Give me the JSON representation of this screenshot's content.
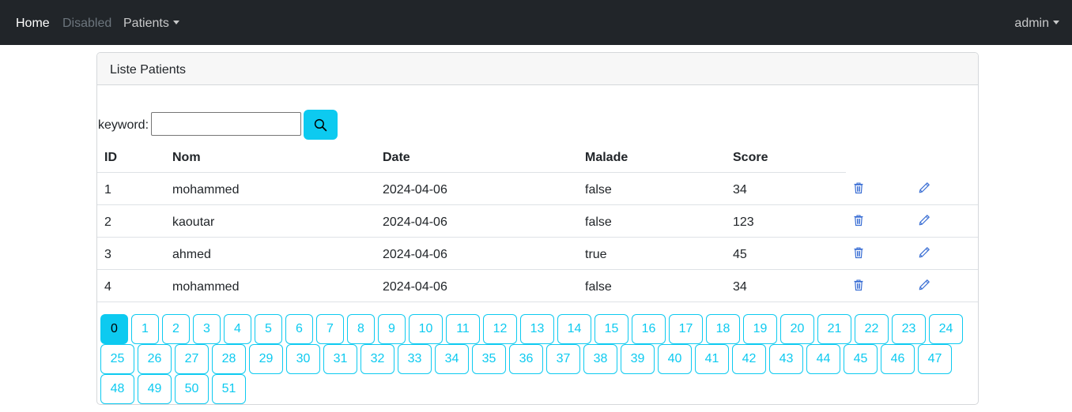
{
  "navbar": {
    "home": "Home",
    "disabled": "Disabled",
    "patients": "Patients",
    "user": "admin"
  },
  "card": {
    "title": "Liste Patients"
  },
  "search": {
    "label": "keyword:",
    "value": "",
    "button_icon": "search-icon"
  },
  "table": {
    "columns": [
      "ID",
      "Nom",
      "Date",
      "Malade",
      "Score"
    ],
    "rows": [
      [
        "1",
        "mohammed",
        "2024-04-06",
        "false",
        "34"
      ],
      [
        "2",
        "kaoutar",
        "2024-04-06",
        "false",
        "123"
      ],
      [
        "3",
        "ahmed",
        "2024-04-06",
        "true",
        "45"
      ],
      [
        "4",
        "mohammed",
        "2024-04-06",
        "false",
        "34"
      ]
    ],
    "row_actions": [
      "trash-icon",
      "pencil-icon"
    ]
  },
  "pagination": {
    "pages": [
      "0",
      "1",
      "2",
      "3",
      "4",
      "5",
      "6",
      "7",
      "8",
      "9",
      "10",
      "11",
      "12",
      "13",
      "14",
      "15",
      "16",
      "17",
      "18",
      "19",
      "20",
      "21",
      "22",
      "23",
      "24",
      "25",
      "26",
      "27",
      "28",
      "29",
      "30",
      "31",
      "32",
      "33",
      "34",
      "35",
      "36",
      "37",
      "38",
      "39",
      "40",
      "41",
      "42",
      "43",
      "44",
      "45",
      "46",
      "47",
      "48",
      "49",
      "50",
      "51"
    ],
    "current": "0"
  },
  "colors": {
    "navbar_bg": "#212529",
    "info": "#0dcaf0",
    "action_icon": "#3b6fd4"
  }
}
